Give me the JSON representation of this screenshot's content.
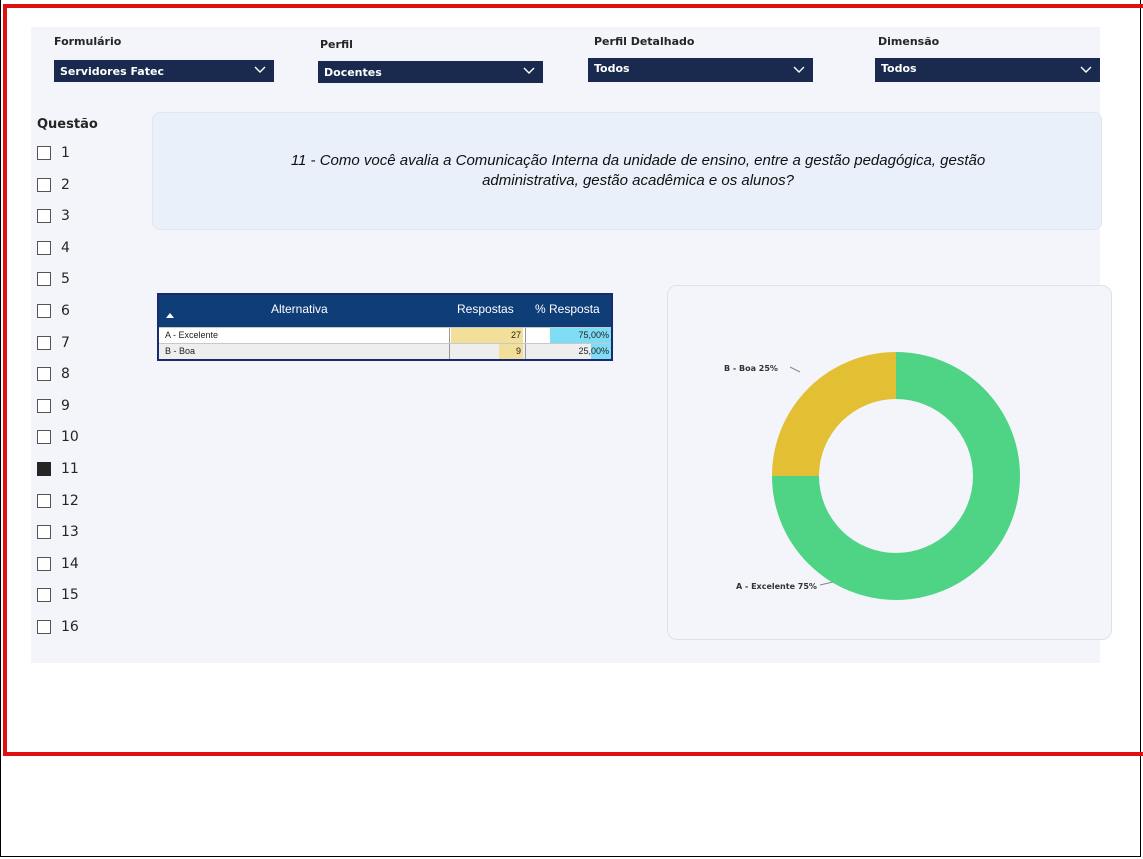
{
  "filters": [
    {
      "label": "Formulário",
      "value": "Servidores Fatec"
    },
    {
      "label": "Perfil",
      "value": "Docentes"
    },
    {
      "label": "Perfil Detalhado",
      "value": "Todos"
    },
    {
      "label": "Dimensão",
      "value": "Todos"
    }
  ],
  "questions": {
    "label": "Questão",
    "items": [
      "1",
      "2",
      "3",
      "4",
      "5",
      "6",
      "7",
      "8",
      "9",
      "10",
      "11",
      "12",
      "13",
      "14",
      "15",
      "16"
    ],
    "selected": "11"
  },
  "question_text": {
    "line1": "11 - Como você avalia a Comunicação Interna da unidade de ensino, entre a gestão pedagógica, gestão",
    "line2": "administrativa, gestão acadêmica e os alunos?"
  },
  "table": {
    "headers": {
      "alternativa": "Alternativa",
      "respostas": "Respostas",
      "pct": "% Resposta"
    },
    "rows": [
      {
        "alternativa": "A - Excelente",
        "respostas": "27",
        "pct": "75,00%",
        "fraction": 0.75
      },
      {
        "alternativa": "B - Boa",
        "respostas": "9",
        "pct": "25,00%",
        "fraction": 0.25
      }
    ],
    "max_respostas": 27
  },
  "chart_data": {
    "type": "pie",
    "categories": [
      "A - Excelente",
      "B - Boa"
    ],
    "values": [
      75,
      25
    ],
    "labels": [
      "A - Excelente 75%",
      "B - Boa 25%"
    ],
    "colors": [
      "#4fd486",
      "#e2bf33"
    ],
    "donut": true
  }
}
